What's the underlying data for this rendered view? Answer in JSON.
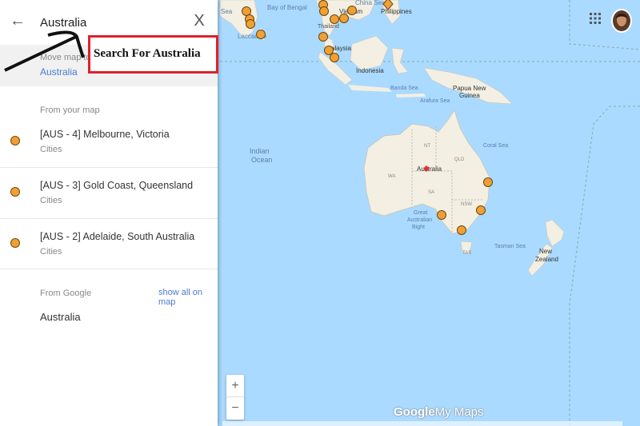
{
  "search": {
    "value": "Australia",
    "back_icon": "arrow-left-icon",
    "clear_label": "X"
  },
  "move_map": {
    "label": "Move map to",
    "link": "Australia"
  },
  "from_your_map": {
    "title": "From your map",
    "items": [
      {
        "title": "[AUS - 4] Melbourne, Victoria",
        "subtitle": "Cities"
      },
      {
        "title": "[AUS - 3] Gold Coast, Queensland",
        "subtitle": "Cities"
      },
      {
        "title": "[AUS - 2] Adelaide, South Australia",
        "subtitle": "Cities"
      }
    ],
    "marker_color": "#f0a033"
  },
  "from_google": {
    "title": "From Google",
    "show_all": "show all on map",
    "result": "Australia"
  },
  "annotation": {
    "text": "Search For Australia",
    "border_color": "#e0202a"
  },
  "map": {
    "labels": {
      "bay_of_bengal": "Bay of Bengal",
      "sea": "Sea",
      "china_sea": "China Sea",
      "philippines": "Philippines",
      "laccadive": "Laccadive",
      "thailand": "Thailand",
      "vietnam": "Vietnam",
      "malaysia": "alaysia",
      "indonesia": "Indonesia",
      "banda_sea": "Banda Sea",
      "papua": "Papua New",
      "guinea": "Guinea",
      "arafura": "Arafura Sea",
      "indian": "Indian",
      "ocean": "Ocean",
      "coral_sea": "Coral Sea",
      "nt": "NT",
      "qld": "QLD",
      "wa": "WA",
      "sa": "SA",
      "nsw": "NSW",
      "australia": "Australia",
      "great": "Great",
      "australian": "Australian",
      "bight": "Bight",
      "tasman": "Tasman Sea",
      "new": "New",
      "zealand": "Zealand",
      "tas": "TAS"
    },
    "water_color": "#aadaff",
    "land_color": "#f3efe2"
  },
  "zoom": {
    "in": "+",
    "out": "−"
  },
  "logo": {
    "google": "Google",
    "my_maps": "My Maps"
  }
}
